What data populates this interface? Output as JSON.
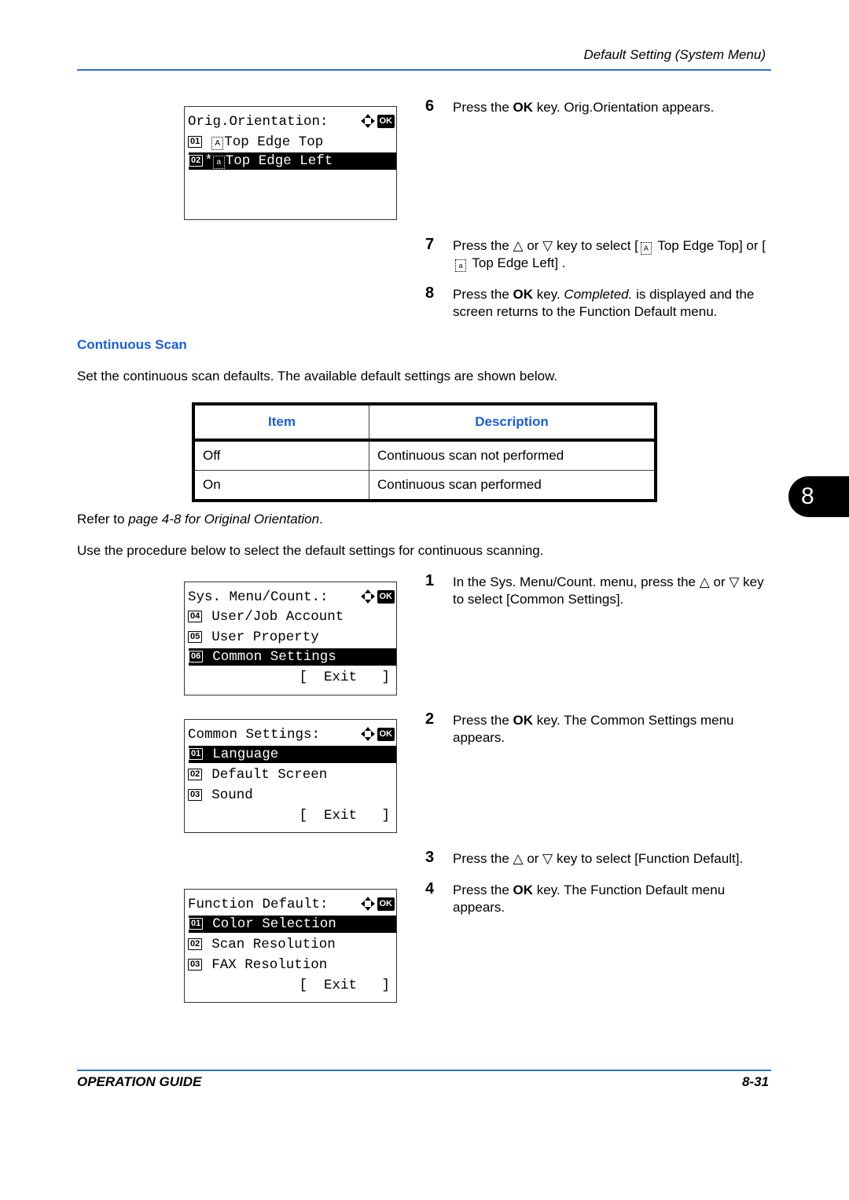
{
  "header": {
    "title": "Default Setting (System Menu)"
  },
  "footer": {
    "left": "OPERATION GUIDE",
    "page": "8-31"
  },
  "chapter_tab": "8",
  "colors": {
    "accent_blue": "#1a5fe0",
    "rule_blue": "#2a6fdb"
  },
  "lcd_orientation": {
    "title": "Orig.Orientation:",
    "ok_label": "OK",
    "rows": [
      {
        "num": "01",
        "prefix": " ",
        "icon": "A",
        "label": "Top Edge Top",
        "selected": false
      },
      {
        "num": "02",
        "prefix": "*",
        "icon": "a",
        "label": "Top Edge Left",
        "selected": true
      }
    ]
  },
  "steps_top": [
    {
      "n": "6",
      "parts": [
        "Press the ",
        "OK",
        " key. Orig.Orientation appears."
      ]
    },
    {
      "n": "7",
      "text_a": "Press the △ or ▽ key to select [",
      "icon1": "A",
      "text_b": " Top Edge Top] or [",
      "icon2": "a",
      "text_c": " Top Edge Left] ."
    },
    {
      "n": "8",
      "a": "Press the ",
      "b": "OK",
      "c": " key. ",
      "d": "Completed.",
      "e": " is displayed and the screen returns to the Function Default menu."
    }
  ],
  "section": {
    "heading": "Continuous Scan",
    "intro": "Set the continuous scan defaults. The available default settings are shown below.",
    "table": {
      "headers": [
        "Item",
        "Description"
      ],
      "rows": [
        [
          "Off",
          "Continuous scan not performed"
        ],
        [
          "On",
          "Continuous scan performed"
        ]
      ]
    },
    "refer_prefix": "Refer to ",
    "refer_italic": "page 4-8 for Original Orientation",
    "refer_suffix": ".",
    "procedure": "Use the procedure below to select the default settings for continuous scanning."
  },
  "lcd_sysmenu": {
    "title": "Sys. Menu/Count.:",
    "ok_label": "OK",
    "rows": [
      {
        "num": "04",
        "label": "User/Job Account",
        "selected": false
      },
      {
        "num": "05",
        "label": "User Property",
        "selected": false
      },
      {
        "num": "06",
        "label": "Common Settings",
        "selected": true
      }
    ],
    "exit": "[  Exit   ]"
  },
  "lcd_common": {
    "title": "Common Settings:",
    "ok_label": "OK",
    "rows": [
      {
        "num": "01",
        "label": "Language",
        "selected": true
      },
      {
        "num": "02",
        "label": "Default Screen",
        "selected": false
      },
      {
        "num": "03",
        "label": "Sound",
        "selected": false
      }
    ],
    "exit": "[  Exit   ]"
  },
  "lcd_function": {
    "title": "Function Default:",
    "ok_label": "OK",
    "rows": [
      {
        "num": "01",
        "label": "Color Selection",
        "selected": true
      },
      {
        "num": "02",
        "label": "Scan Resolution",
        "selected": false
      },
      {
        "num": "03",
        "label": "FAX Resolution",
        "selected": false
      }
    ],
    "exit": "[  Exit   ]"
  },
  "steps_bottom": [
    {
      "n": "1",
      "a": "In the Sys. Menu/Count. menu, press the △ or ▽ key to select [Common Settings]."
    },
    {
      "n": "2",
      "a": "Press the ",
      "b": "OK",
      "c": " key. The Common Settings menu appears."
    },
    {
      "n": "3",
      "a": "Press the △ or ▽ key to select [Function Default]."
    },
    {
      "n": "4",
      "a": "Press the ",
      "b": "OK",
      "c": " key. The Function Default menu appears."
    }
  ]
}
